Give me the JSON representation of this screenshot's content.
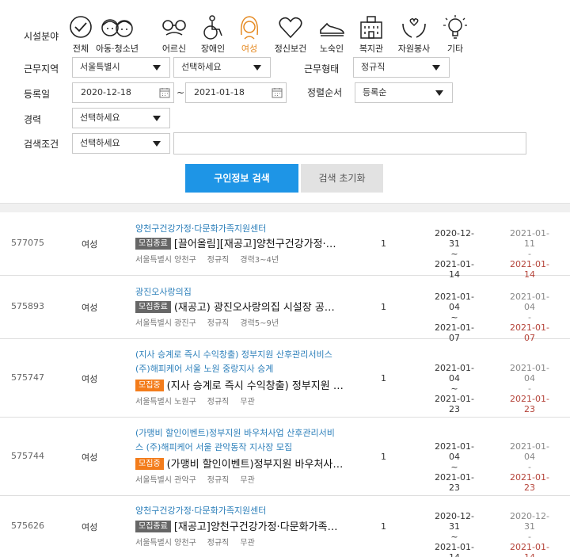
{
  "filters": {
    "category_label": "시설분야",
    "categories": [
      {
        "name": "전체",
        "icon": "check-circle-icon"
      },
      {
        "name": "아동·청소년",
        "icon": "children-icon"
      },
      {
        "name": "어르신",
        "icon": "elderly-icon"
      },
      {
        "name": "장애인",
        "icon": "wheelchair-icon"
      },
      {
        "name": "여성",
        "icon": "woman-icon",
        "active": true
      },
      {
        "name": "정신보건",
        "icon": "heart-icon"
      },
      {
        "name": "노숙인",
        "icon": "shoe-icon"
      },
      {
        "name": "복지관",
        "icon": "building-icon"
      },
      {
        "name": "자원봉사",
        "icon": "volunteer-hands-icon"
      },
      {
        "name": "기타",
        "icon": "lightbulb-icon"
      }
    ],
    "region_label": "근무지역",
    "region_value": "서울특별시",
    "district_value": "선택하세요",
    "employment_label": "근무형태",
    "employment_value": "정규직",
    "date_label": "등록일",
    "date_from": "2020-12-18",
    "date_sep": "~",
    "date_to": "2021-01-18",
    "sort_label": "정렬순서",
    "sort_value": "등록순",
    "career_label": "경력",
    "career_value": "선택하세요",
    "condition_label": "검색조건",
    "condition_value": "선택하세요",
    "keyword_value": "",
    "search_button": "구인정보 검색",
    "reset_button": "검색 초기화",
    "accent_color": "#1e95e6",
    "active_color": "#e58a22"
  },
  "listings": [
    {
      "id": "577075",
      "target": "여성",
      "org_lines": [
        "양천구건강가정·다문화가족지원센터"
      ],
      "badge": "모집종료",
      "badge_state": "closed",
      "title": "[끌어올림][재공고]양천구건강가정·…",
      "location": "서울특별시 양천구",
      "type": "정규직",
      "career": "경력3~4년",
      "count": "1",
      "period_start": "2020-12-31",
      "period_sep": "~",
      "period_end": "2021-01-14",
      "reg_date": "2021-01-11",
      "reg_sep": "-",
      "deadline": "2021-01-14"
    },
    {
      "id": "575893",
      "target": "여성",
      "org_lines": [
        "광진오사랑의집"
      ],
      "badge": "모집종료",
      "badge_state": "closed",
      "title": "(재공고) 광진오사랑의집 시설장 공…",
      "location": "서울특별시 광진구",
      "type": "정규직",
      "career": "경력5~9년",
      "count": "1",
      "period_start": "2021-01-04",
      "period_sep": "~",
      "period_end": "2021-01-07",
      "reg_date": "2021-01-04",
      "reg_sep": "-",
      "deadline": "2021-01-07"
    },
    {
      "id": "575747",
      "target": "여성",
      "org_lines": [
        "(지사 승계로 즉시 수익창출) 정부지원 산후관리서비스",
        "(주)해피케어 서울 노원 중랑지사 승계"
      ],
      "badge": "모집중",
      "badge_state": "open",
      "title": "(지사 승계로 즉시 수익창출) 정부지원 …",
      "location": "서울특별시 노원구",
      "type": "정규직",
      "career": "무관",
      "count": "1",
      "period_start": "2021-01-04",
      "period_sep": "~",
      "period_end": "2021-01-23",
      "reg_date": "2021-01-04",
      "reg_sep": "-",
      "deadline": "2021-01-23"
    },
    {
      "id": "575744",
      "target": "여성",
      "org_lines": [
        "(가맹비 할인이벤트)정부지원 바우처사업 산후관리서비",
        "스 (주)해피케어 서울 관악동작 지사장 모집"
      ],
      "badge": "모집중",
      "badge_state": "open",
      "title": "(가맹비 할인이벤트)정부지원 바우처사…",
      "location": "서울특별시 관악구",
      "type": "정규직",
      "career": "무관",
      "count": "1",
      "period_start": "2021-01-04",
      "period_sep": "~",
      "period_end": "2021-01-23",
      "reg_date": "2021-01-04",
      "reg_sep": "-",
      "deadline": "2021-01-23"
    },
    {
      "id": "575626",
      "target": "여성",
      "org_lines": [
        "양천구건강가정·다문화가족지원센터"
      ],
      "badge": "모집종료",
      "badge_state": "closed",
      "title": "[재공고]양천구건강가정·다문화가족…",
      "location": "서울특별시 양천구",
      "type": "정규직",
      "career": "무관",
      "count": "1",
      "period_start": "2020-12-31",
      "period_sep": "~",
      "period_end": "2021-01-14",
      "reg_date": "2020-12-31",
      "reg_sep": "-",
      "deadline": "2021-01-14"
    }
  ]
}
